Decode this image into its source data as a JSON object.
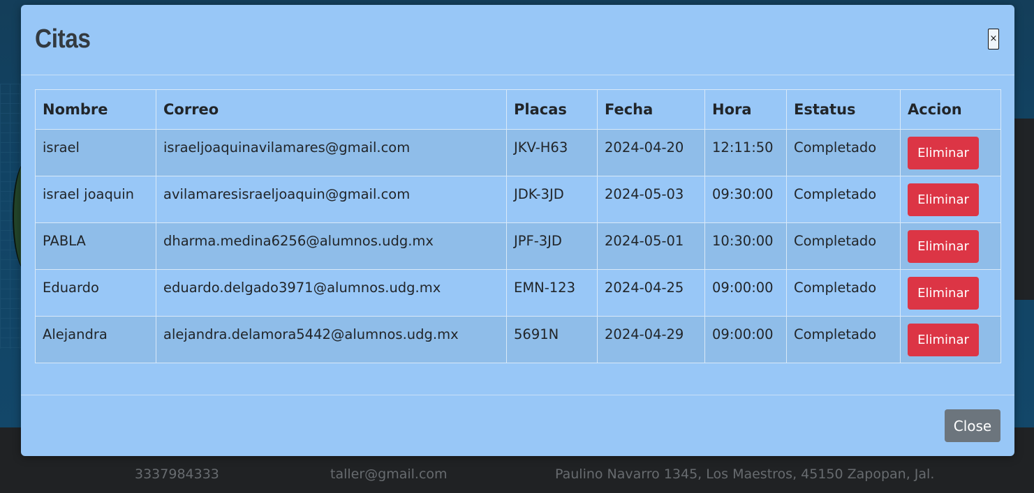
{
  "modal": {
    "title": "Citas",
    "close_x": "×",
    "close_button": "Close"
  },
  "table": {
    "headers": [
      "Nombre",
      "Correo",
      "Placas",
      "Fecha",
      "Hora",
      "Estatus",
      "Accion"
    ],
    "rows": [
      {
        "nombre": "israel",
        "correo": "israeljoaquinavilamares@gmail.com",
        "placas": "JKV-H63",
        "fecha": "2024-04-20",
        "hora": "12:11:50",
        "estatus": "Completado",
        "accion": "Eliminar"
      },
      {
        "nombre": "israel joaquin",
        "correo": "avilamaresisraeljoaquin@gmail.com",
        "placas": "JDK-3JD",
        "fecha": "2024-05-03",
        "hora": "09:30:00",
        "estatus": "Completado",
        "accion": "Eliminar"
      },
      {
        "nombre": "PABLA",
        "correo": "dharma.medina6256@alumnos.udg.mx",
        "placas": "JPF-3JD",
        "fecha": "2024-05-01",
        "hora": "10:30:00",
        "estatus": "Completado",
        "accion": "Eliminar"
      },
      {
        "nombre": "Eduardo",
        "correo": "eduardo.delgado3971@alumnos.udg.mx",
        "placas": "EMN-123",
        "fecha": "2024-04-25",
        "hora": "09:00:00",
        "estatus": "Completado",
        "accion": "Eliminar"
      },
      {
        "nombre": "Alejandra",
        "correo": "alejandra.delamora5442@alumnos.udg.mx",
        "placas": "5691N",
        "fecha": "2024-04-29",
        "hora": "09:00:00",
        "estatus": "Completado",
        "accion": "Eliminar"
      }
    ]
  },
  "footer": {
    "phone": "3337984333",
    "email": "taller@gmail.com",
    "address": "Paulino Navarro 1345, Los Maestros, 45150 Zapopan, Jal."
  },
  "colors": {
    "modal_bg": "#98c7f7",
    "danger": "#dc3545",
    "secondary": "#6c757d"
  }
}
